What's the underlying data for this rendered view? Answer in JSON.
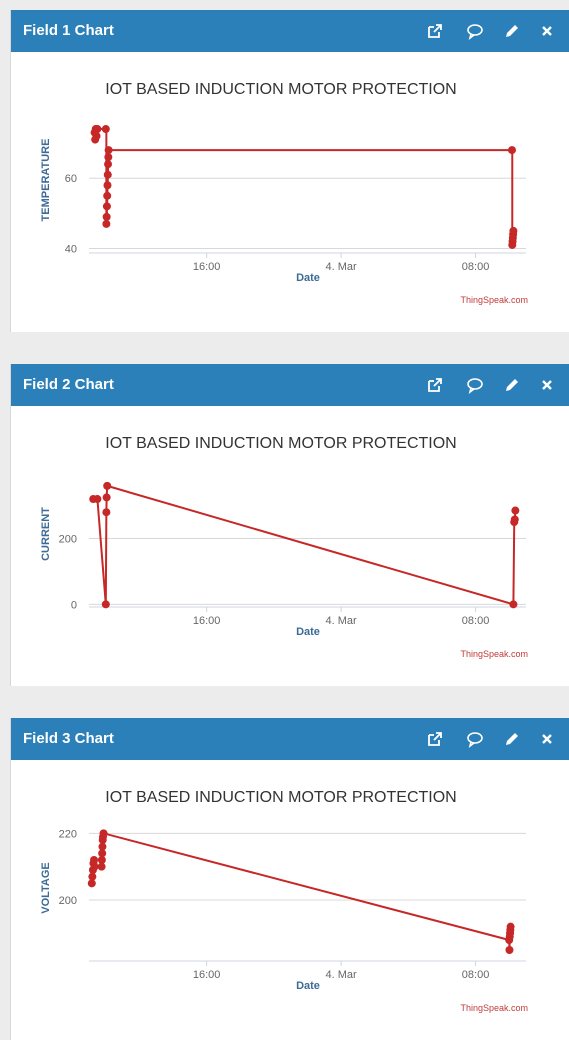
{
  "colors": {
    "header": "#2b80b9",
    "series": "#c62828",
    "grid": "#d8d8d8",
    "axis_title": "#3d6b95",
    "credit": "#c23b3b"
  },
  "icons": [
    "external-link-icon",
    "comment-icon",
    "pencil-icon",
    "close-icon"
  ],
  "panels": [
    {
      "title": "Field 1 Chart",
      "chart_data": {
        "type": "line",
        "title": "IOT BASED INDUCTION MOTOR PROTECTION",
        "xlabel": "Date",
        "ylabel": "TEMPERATURE",
        "credit": "ThingSpeak.com",
        "x_range": [
          "2024-03-03 09:00",
          "2024-03-04 11:00"
        ],
        "x_ticks": [
          {
            "label": "16:00",
            "x": "2024-03-03 16:00"
          },
          {
            "label": "4. Mar",
            "x": "2024-03-04 00:00"
          },
          {
            "label": "08:00",
            "x": "2024-03-04 08:00"
          }
        ],
        "ylim": [
          39,
          76
        ],
        "y_ticks": [
          40,
          60
        ],
        "grid": true,
        "line_style": "step",
        "series": [
          {
            "points": [
              [
                "2024-03-03 09:20",
                73
              ],
              [
                "2024-03-03 09:22",
                71
              ],
              [
                "2024-03-03 09:24",
                74
              ],
              [
                "2024-03-03 09:27",
                72
              ],
              [
                "2024-03-03 09:30",
                74
              ],
              [
                "2024-03-03 10:00",
                74
              ],
              [
                "2024-03-03 10:02",
                47
              ],
              [
                "2024-03-03 10:03",
                49
              ],
              [
                "2024-03-03 10:04",
                52
              ],
              [
                "2024-03-03 10:05",
                55
              ],
              [
                "2024-03-03 10:06",
                58
              ],
              [
                "2024-03-03 10:07",
                61
              ],
              [
                "2024-03-03 10:08",
                64
              ],
              [
                "2024-03-03 10:09",
                66
              ],
              [
                "2024-03-03 10:10",
                68
              ],
              [
                "2024-03-04 10:10",
                68
              ],
              [
                "2024-03-04 10:11",
                41
              ],
              [
                "2024-03-04 10:12",
                42
              ],
              [
                "2024-03-04 10:13",
                43
              ],
              [
                "2024-03-04 10:14",
                44
              ],
              [
                "2024-03-04 10:15",
                45
              ]
            ]
          }
        ]
      }
    },
    {
      "title": "Field 2 Chart",
      "chart_data": {
        "type": "line",
        "title": "IOT BASED INDUCTION MOTOR PROTECTION",
        "xlabel": "Date",
        "ylabel": "CURRENT",
        "credit": "ThingSpeak.com",
        "x_range": [
          "2024-03-03 09:00",
          "2024-03-04 11:00"
        ],
        "x_ticks": [
          {
            "label": "16:00",
            "x": "2024-03-03 16:00"
          },
          {
            "label": "4. Mar",
            "x": "2024-03-04 00:00"
          },
          {
            "label": "08:00",
            "x": "2024-03-04 08:00"
          }
        ],
        "ylim": [
          -5,
          390
        ],
        "y_ticks": [
          0,
          200
        ],
        "grid": true,
        "line_style": "straight",
        "series": [
          {
            "points": [
              [
                "2024-03-03 09:15",
                320
              ],
              [
                "2024-03-03 09:30",
                320
              ],
              [
                "2024-03-03 10:00",
                0
              ],
              [
                "2024-03-03 10:02",
                280
              ],
              [
                "2024-03-03 10:03",
                325
              ],
              [
                "2024-03-03 10:05",
                360
              ],
              [
                "2024-03-04 10:15",
                0
              ],
              [
                "2024-03-04 10:18",
                250
              ],
              [
                "2024-03-04 10:20",
                258
              ],
              [
                "2024-03-04 10:22",
                285
              ]
            ]
          }
        ]
      }
    },
    {
      "title": "Field 3 Chart",
      "chart_data": {
        "type": "line",
        "title": "IOT BASED INDUCTION MOTOR PROTECTION",
        "xlabel": "Date",
        "ylabel": "VOLTAGE",
        "credit": "ThingSpeak.com",
        "x_range": [
          "2024-03-03 09:00",
          "2024-03-04 11:00"
        ],
        "x_ticks": [
          {
            "label": "16:00",
            "x": "2024-03-03 16:00"
          },
          {
            "label": "4. Mar",
            "x": "2024-03-04 00:00"
          },
          {
            "label": "08:00",
            "x": "2024-03-04 08:00"
          }
        ],
        "ylim": [
          182,
          221
        ],
        "y_ticks": [
          200,
          220
        ],
        "grid": true,
        "line_style": "straight",
        "series": [
          {
            "points": [
              [
                "2024-03-03 09:10",
                205
              ],
              [
                "2024-03-03 09:12",
                207
              ],
              [
                "2024-03-03 09:14",
                209
              ],
              [
                "2024-03-03 09:16",
                211
              ],
              [
                "2024-03-03 09:18",
                212
              ],
              [
                "2024-03-03 09:20",
                210
              ],
              [
                "2024-03-03 09:45",
                210
              ],
              [
                "2024-03-03 09:46",
                212
              ],
              [
                "2024-03-03 09:47",
                214
              ],
              [
                "2024-03-03 09:48",
                216
              ],
              [
                "2024-03-03 09:49",
                218
              ],
              [
                "2024-03-03 09:50",
                219
              ],
              [
                "2024-03-03 09:52",
                220
              ],
              [
                "2024-03-04 10:00",
                188
              ],
              [
                "2024-03-04 10:01",
                185
              ],
              [
                "2024-03-04 10:02",
                189
              ],
              [
                "2024-03-04 10:03",
                190
              ],
              [
                "2024-03-04 10:04",
                191
              ],
              [
                "2024-03-04 10:05",
                192
              ]
            ]
          }
        ]
      }
    }
  ]
}
